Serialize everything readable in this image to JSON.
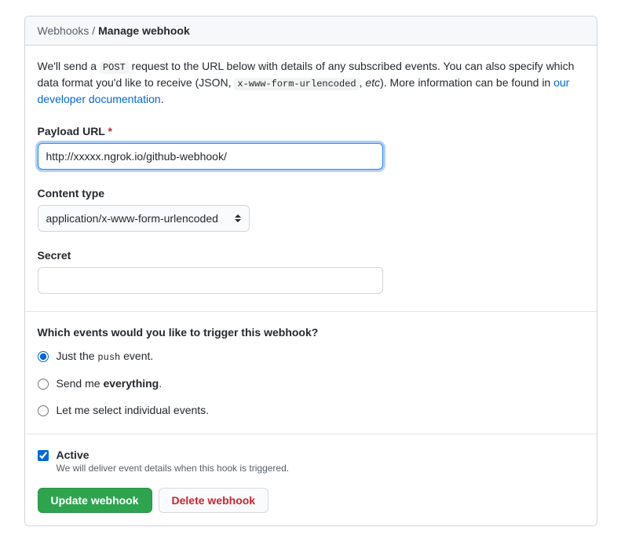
{
  "header": {
    "crumb": "Webhooks / ",
    "current": "Manage webhook"
  },
  "intro": {
    "text1": "We'll send a ",
    "code1": "POST",
    "text2": " request to the URL below with details of any subscribed events. You can also specify which data format you'd like to receive (JSON, ",
    "code2": "x-www-form-urlencoded",
    "text3": ", ",
    "em1": "etc",
    "text4": "). More information can be found in ",
    "link": "our developer documentation",
    "text5": "."
  },
  "payload": {
    "label": "Payload URL",
    "value": "http://xxxxx.ngrok.io/github-webhook/"
  },
  "content_type": {
    "label": "Content type",
    "selected": "application/x-www-form-urlencoded"
  },
  "secret": {
    "label": "Secret",
    "value": ""
  },
  "events": {
    "heading": "Which events would you like to trigger this webhook?",
    "opt1a": "Just the ",
    "opt1code": "push",
    "opt1b": " event.",
    "opt2a": "Send me ",
    "opt2strong": "everything",
    "opt2b": ".",
    "opt3": "Let me select individual events."
  },
  "active": {
    "label": "Active",
    "desc": "We will deliver event details when this hook is triggered."
  },
  "buttons": {
    "update": "Update webhook",
    "delete": "Delete webhook"
  }
}
